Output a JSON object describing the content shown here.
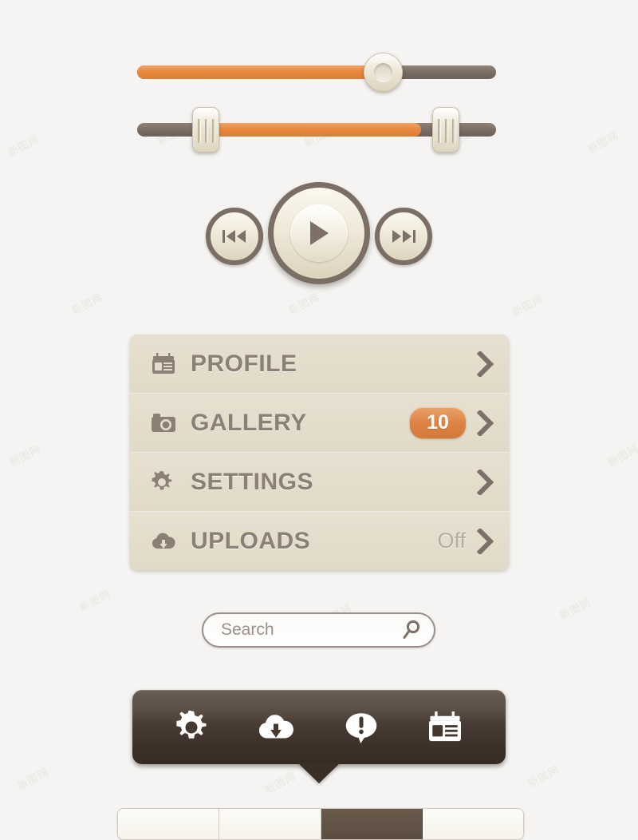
{
  "background": {
    "color": "#f5f4f2",
    "watermark_text": "新图网"
  },
  "palette": {
    "orange": "#e8883f",
    "track_gray": "#7d7068",
    "cream": "#ece5d5",
    "text_brown": "#8b8076",
    "dark_brown": "#3d3229",
    "panel_bg": "#e4ddcc",
    "muted_text": "#b5aca1"
  },
  "sliders": [
    {
      "name": "volume-slider",
      "handle": "round-knob",
      "fill_percent": 68,
      "value_label": ""
    },
    {
      "name": "range-slider",
      "handle": "rect-grip",
      "range_start_percent": 17,
      "range_end_percent": 79,
      "value_label": ""
    }
  ],
  "media_controls": {
    "previous": {
      "label": "Previous",
      "icon": "rewind-icon"
    },
    "play": {
      "label": "Play",
      "icon": "play-icon"
    },
    "next": {
      "label": "Next",
      "icon": "fast-forward-icon"
    }
  },
  "menu": {
    "rows": [
      {
        "label": "PROFILE",
        "icon": "contact-card-icon",
        "badge": "",
        "value": ""
      },
      {
        "label": "GALLERY",
        "icon": "camera-icon",
        "badge": "10",
        "value": ""
      },
      {
        "label": "SETTINGS",
        "icon": "gear-icon",
        "badge": "",
        "value": ""
      },
      {
        "label": "UPLOADS",
        "icon": "cloud-download-icon",
        "badge": "",
        "value": "Off"
      }
    ],
    "chevron_icon": "chevron-right-icon"
  },
  "search": {
    "placeholder": "Search",
    "value": "",
    "icon": "search-icon"
  },
  "toolbar": {
    "items": [
      {
        "icon": "gear-icon",
        "label": "Settings"
      },
      {
        "icon": "cloud-download-icon",
        "label": "Downloads"
      },
      {
        "icon": "alert-bubble-icon",
        "label": "Alerts"
      },
      {
        "icon": "contact-card-icon",
        "label": "Contacts"
      }
    ]
  },
  "segmented_control": {
    "segments": [
      {
        "label": "",
        "active": false
      },
      {
        "label": "",
        "active": false
      },
      {
        "label": "",
        "active": true
      },
      {
        "label": "",
        "active": false
      }
    ]
  }
}
